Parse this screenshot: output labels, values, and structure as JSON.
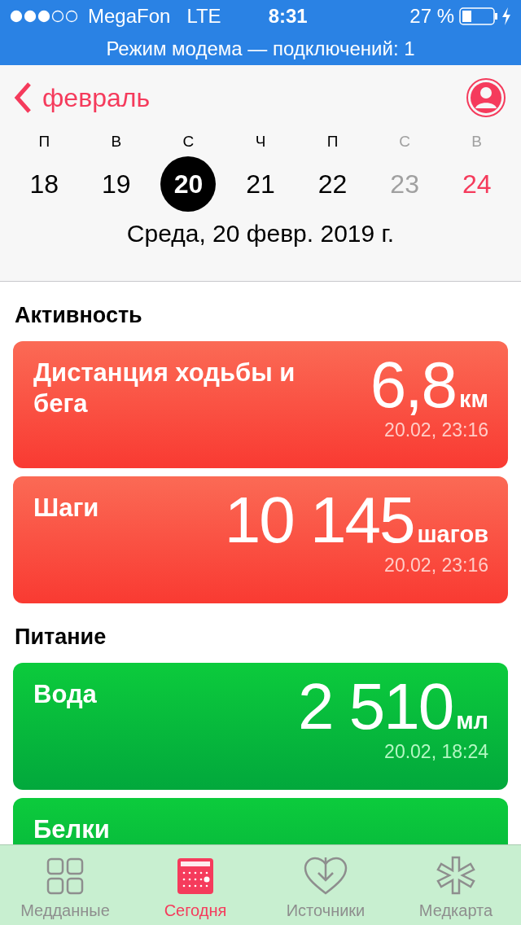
{
  "status_bar": {
    "carrier": "MegaFon",
    "network": "LTE",
    "time": "8:31",
    "battery": "27 %"
  },
  "hotspot_banner": "Режим модема — подключений: 1",
  "nav": {
    "back": "февраль"
  },
  "week": [
    {
      "letter": "П",
      "day": "18",
      "weekend": false,
      "kind": "past",
      "selected": false
    },
    {
      "letter": "В",
      "day": "19",
      "weekend": false,
      "kind": "past",
      "selected": false
    },
    {
      "letter": "С",
      "day": "20",
      "weekend": false,
      "kind": "past",
      "selected": true
    },
    {
      "letter": "Ч",
      "day": "21",
      "weekend": false,
      "kind": "past",
      "selected": false
    },
    {
      "letter": "П",
      "day": "22",
      "weekend": false,
      "kind": "past",
      "selected": false
    },
    {
      "letter": "С",
      "day": "23",
      "weekend": true,
      "kind": "future",
      "selected": false
    },
    {
      "letter": "В",
      "day": "24",
      "weekend": true,
      "kind": "today",
      "selected": false
    }
  ],
  "date_caption": "Среда, 20 февр. 2019 г.",
  "sections": [
    {
      "title": "Активность",
      "kind": "activity",
      "cards": [
        {
          "title": "Дистанция ходьбы и бега",
          "value": "6,8",
          "unit": "км",
          "time": "20.02, 23:16"
        },
        {
          "title": "Шаги",
          "value": "10 145",
          "unit": "шагов",
          "time": "20.02, 23:16"
        }
      ]
    },
    {
      "title": "Питание",
      "kind": "nutrition",
      "cards": [
        {
          "title": "Вода",
          "value": "2 510",
          "unit": "мл",
          "time": "20.02, 18:24"
        },
        {
          "title": "Белки"
        }
      ]
    }
  ],
  "tab_bar": [
    {
      "label": "Медданные",
      "selected": false
    },
    {
      "label": "Сегодня",
      "selected": true
    },
    {
      "label": "Источники",
      "selected": false
    },
    {
      "label": "Медкарта",
      "selected": false
    }
  ]
}
